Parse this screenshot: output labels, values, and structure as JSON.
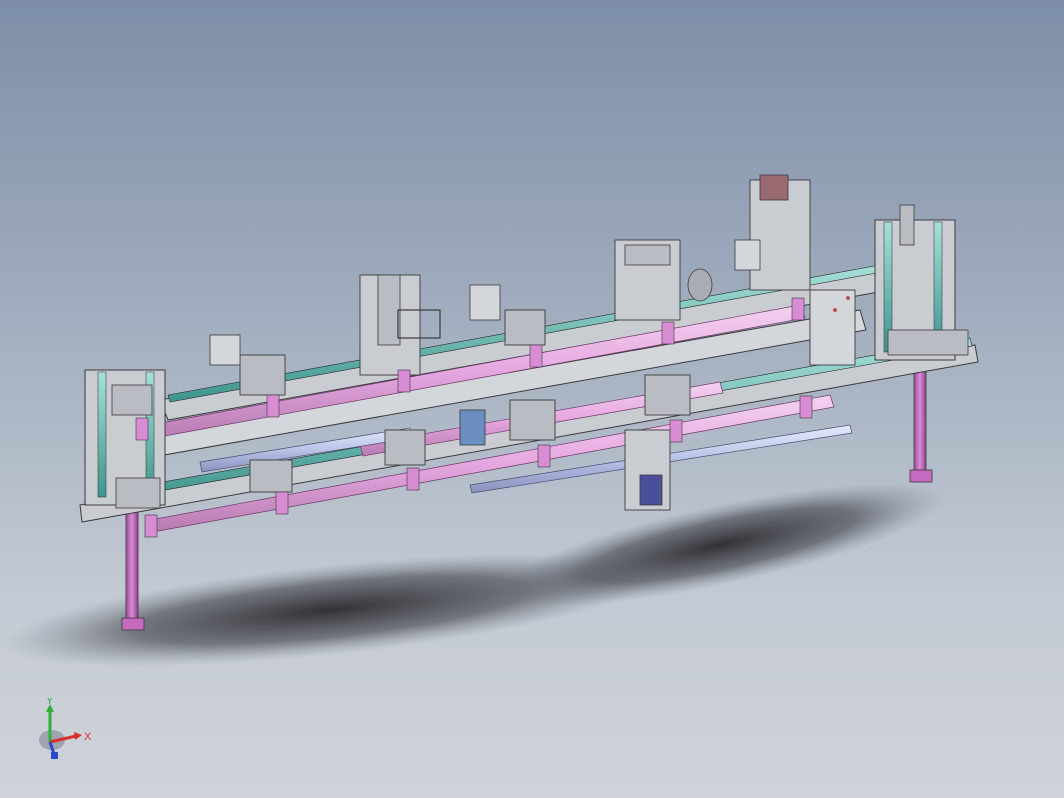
{
  "viewport": {
    "background_top": "#7d8ea8",
    "background_bottom": "#cfd3d9"
  },
  "model": {
    "description_colors": {
      "frame": "#c9ccd1",
      "frame_edge": "#3a3a3a",
      "guide_rail": "#5fb7b0",
      "cylinder": "#e6a7e0",
      "cylinder_rod": "#b9c3e8",
      "leg": "#c46ac0",
      "block": "#b9bcc2",
      "accent_red": "#c0504d"
    }
  },
  "triad": {
    "x_label": "X",
    "y_label": "Y",
    "x_color": "#d9302c",
    "y_color": "#2fae3a",
    "z_color": "#2b48c9"
  }
}
